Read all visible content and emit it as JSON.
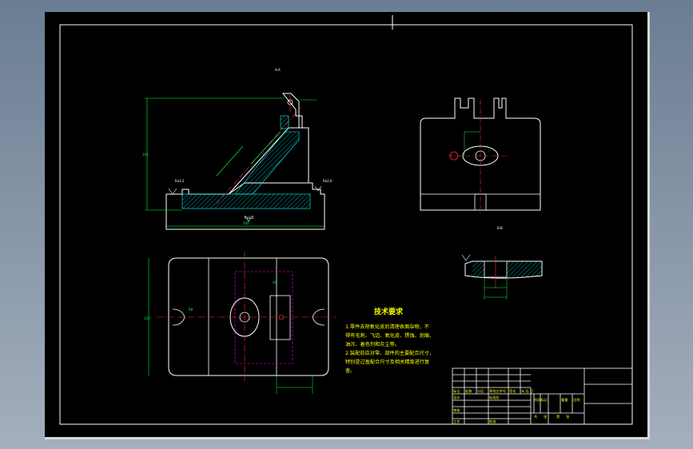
{
  "drawing": {
    "section_labels": {
      "a": "A-A",
      "b": "B-B"
    },
    "dimensions": {
      "overall_height": "165",
      "overall_length": "200",
      "base_width": "120",
      "slot": "R8",
      "plan_depth": "40",
      "roughness_1": "Ra3.2",
      "roughness_2": "Ra1.6",
      "roughness_3": "Ra3.2"
    },
    "tech_requirements": {
      "title": "技术要求",
      "lines": [
        "1.零件去除氧化皮后清理表面杂物，不",
        "得有毛刺、飞边、氧化皮、锈蚀、划痕、",
        "油污、着色剂和灰尘等。",
        "2.装配前应对零、部件的主要配合尺寸，",
        "特别是过盈配合尺寸及相关精度进行复",
        "查。"
      ]
    },
    "title_block": {
      "row1": [
        "标记",
        "处数",
        "分区",
        "更改文件号",
        "签名",
        "年.月.日"
      ],
      "row2": [
        "设计",
        "",
        "标准化",
        "",
        "阶段标记",
        "重量",
        "比例"
      ],
      "row3": [
        "审核",
        "",
        "",
        "",
        "",
        "共",
        "张",
        "第",
        "张"
      ],
      "row4": [
        "工艺",
        "",
        "批准",
        ""
      ]
    }
  }
}
